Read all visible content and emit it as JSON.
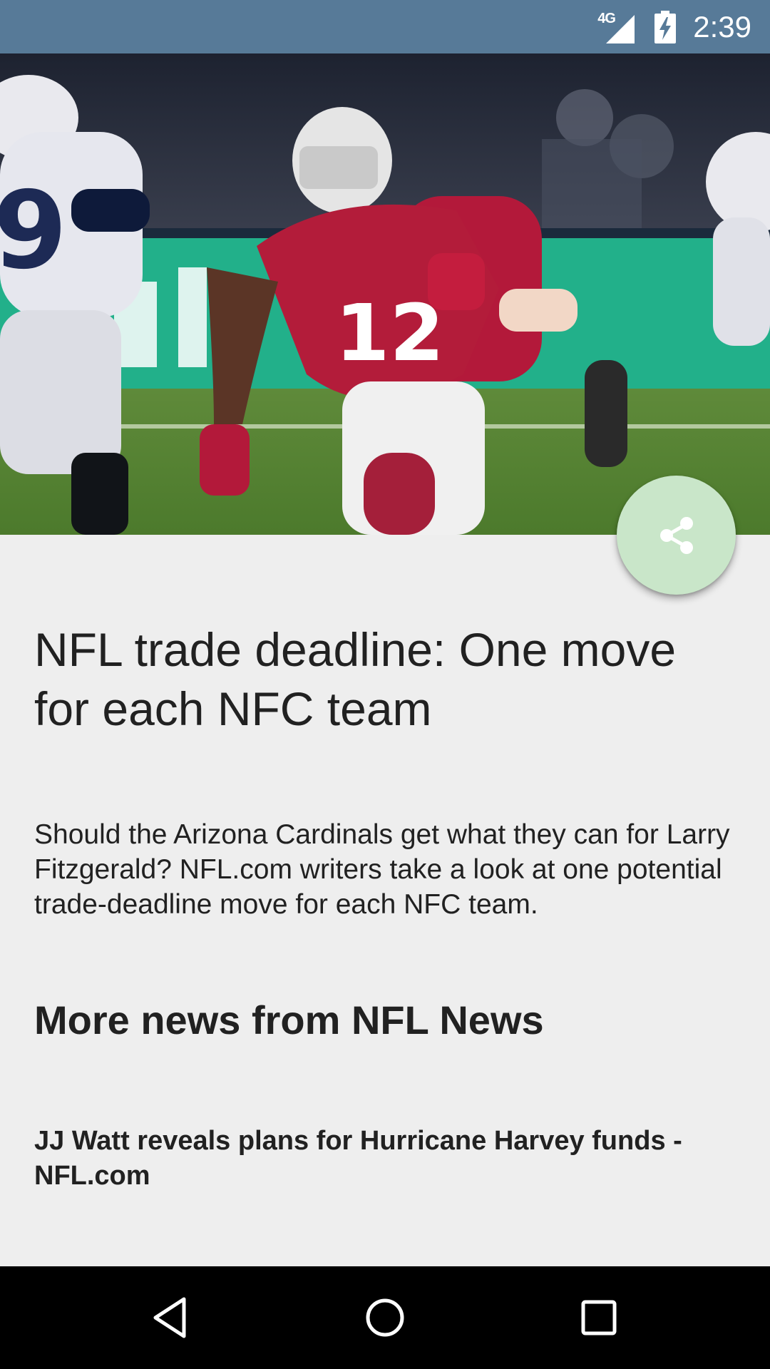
{
  "status_bar": {
    "network_label": "4G",
    "time": "2:39",
    "background_color": "#577a98",
    "icons": [
      "signal-icon",
      "battery-charging-icon"
    ]
  },
  "hero": {
    "image_description_icon": "football-photo",
    "share_button_icon": "share-icon",
    "share_button_color": "#c9e6c9"
  },
  "article": {
    "headline": "NFL trade deadline: One move for each NFC team",
    "summary": "Should the Arizona Cardinals get what they can for Larry Fitzgerald? NFL.com writers take a look at one potential trade-deadline move for each NFC team."
  },
  "more_news": {
    "heading": "More news from NFL News",
    "items": [
      {
        "title": "JJ Watt reveals plans for Hurricane Harvey funds - NFL.com"
      }
    ]
  },
  "nav_bar": {
    "icons": [
      "back-icon",
      "home-icon",
      "recents-icon"
    ]
  }
}
